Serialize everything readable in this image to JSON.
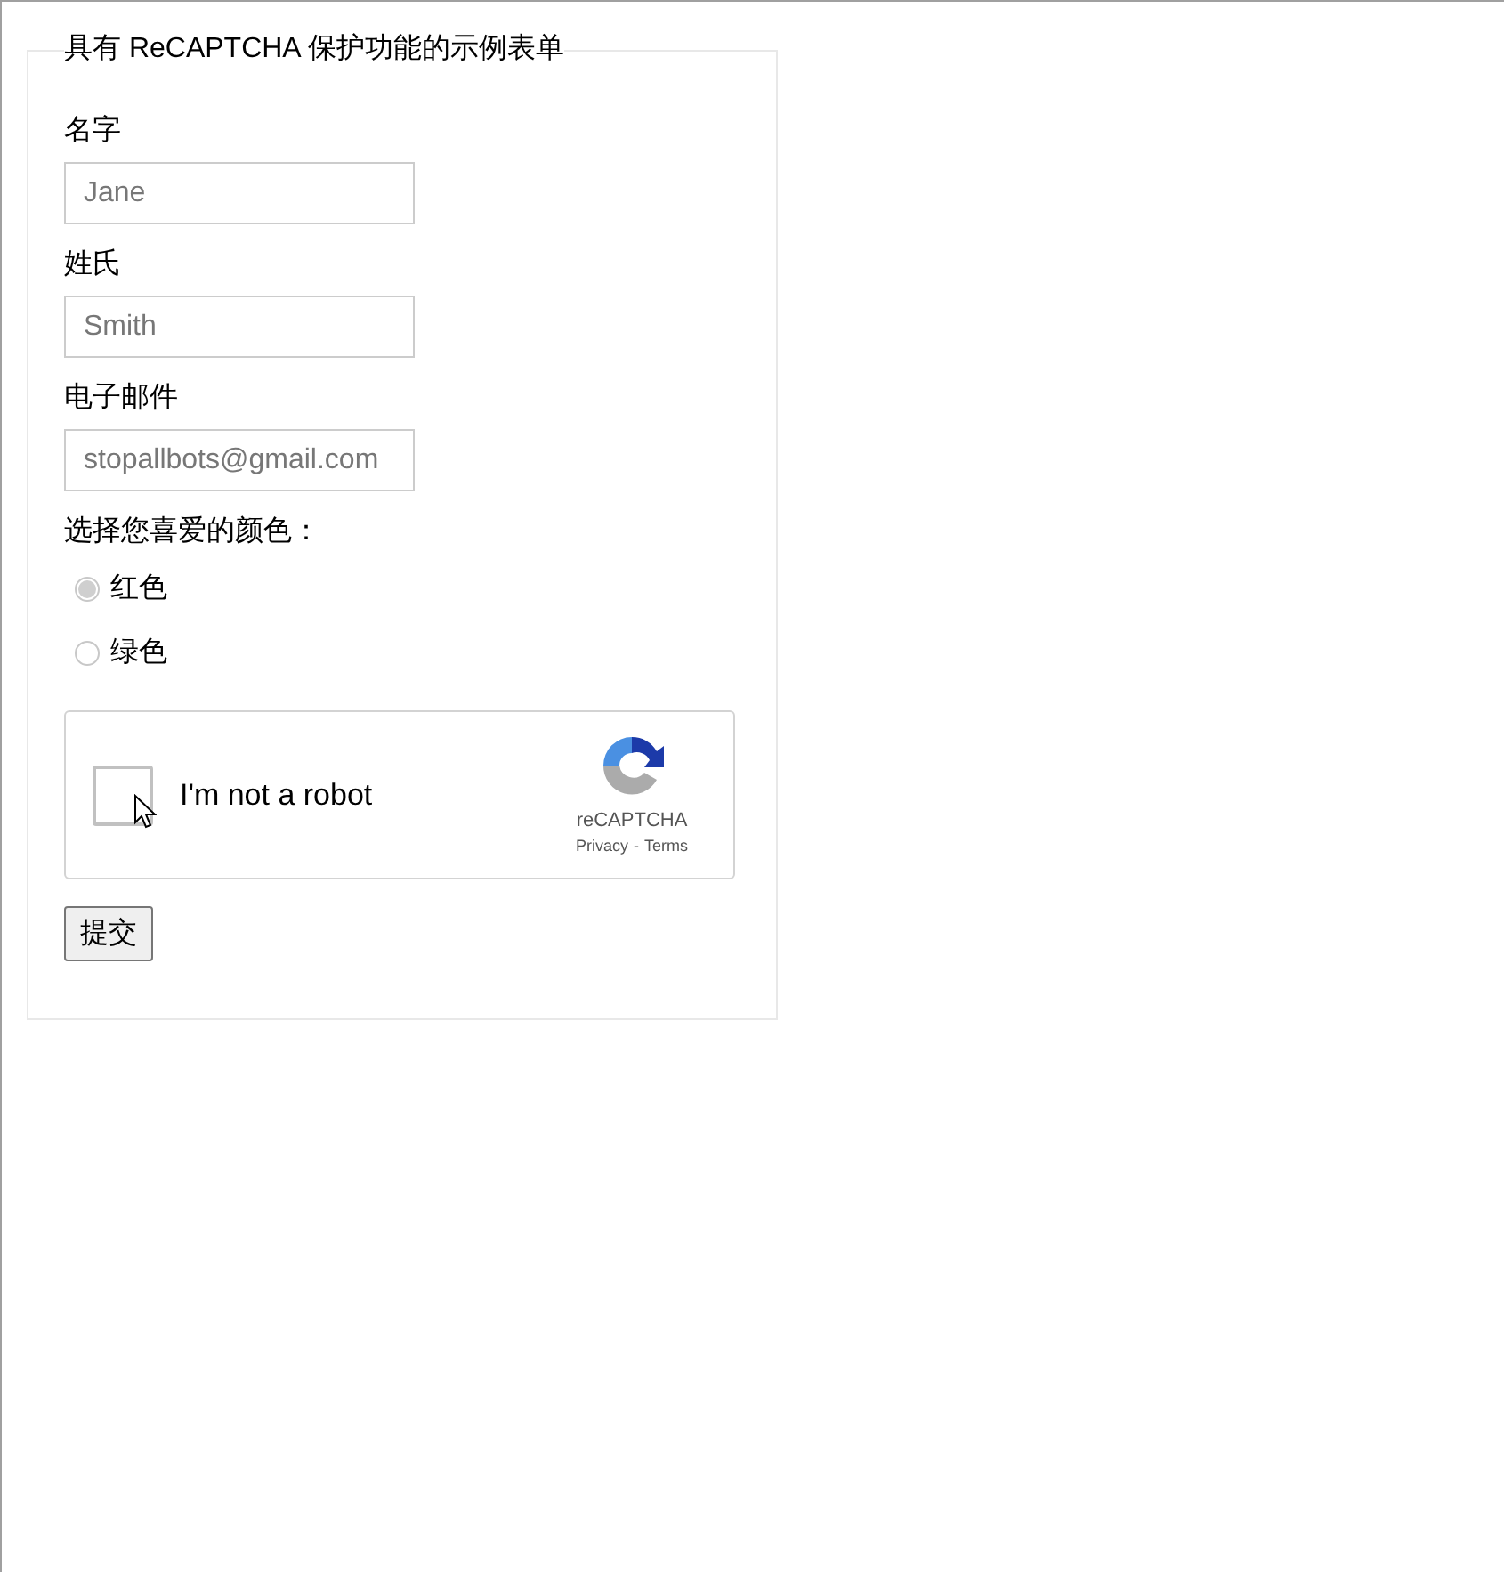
{
  "form": {
    "legend": "具有 ReCAPTCHA 保护功能的示例表单",
    "fields": [
      {
        "label": "名字",
        "placeholder": "Jane"
      },
      {
        "label": "姓氏",
        "placeholder": "Smith"
      },
      {
        "label": "电子邮件",
        "placeholder": "stopallbots@gmail.com"
      }
    ],
    "color_question": "选择您喜爱的颜色：",
    "options": [
      {
        "label": "红色",
        "selected": true
      },
      {
        "label": "绿色",
        "selected": false
      }
    ],
    "captcha": {
      "label": "I'm not a robot",
      "checked": false,
      "brand": "reCAPTCHA",
      "privacy": "Privacy",
      "separator": "-",
      "terms": "Terms"
    },
    "submit": "提交"
  }
}
